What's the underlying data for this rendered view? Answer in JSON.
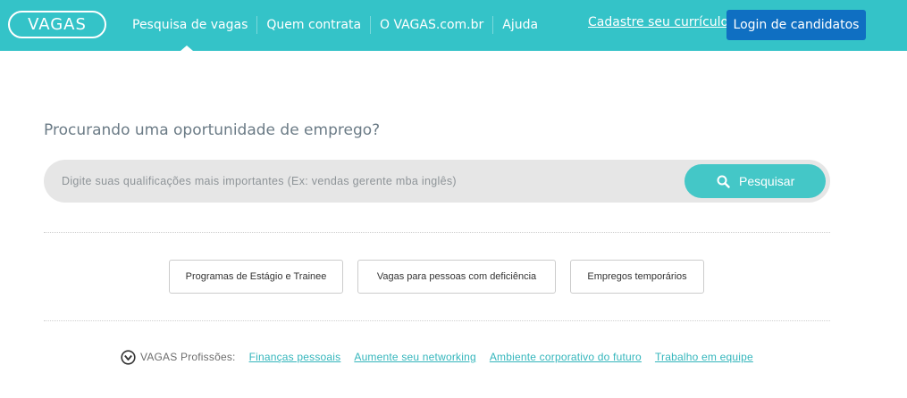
{
  "header": {
    "logo_text": "VAGAS",
    "nav": [
      {
        "label": "Pesquisa de vagas",
        "active": true
      },
      {
        "label": "Quem contrata"
      },
      {
        "label": "O VAGAS.com.br"
      },
      {
        "label": "Ajuda"
      }
    ],
    "signup_link": "Cadastre seu currículo",
    "login_button": "Login de candidatos"
  },
  "search": {
    "headline": "Procurando uma oportunidade de emprego?",
    "placeholder": "Digite suas qualificações mais importantes (Ex: vendas gerente mba inglês)",
    "button_label": "Pesquisar",
    "button_icon": "search-icon"
  },
  "quick_links": [
    "Programas de Estágio e Trainee",
    "Vagas para pessoas com deficiência",
    "Empregos temporários"
  ],
  "professions": {
    "label": "VAGAS Profissões:",
    "icon": "vagas-check-icon",
    "links": [
      "Finanças pessoais",
      "Aumente seu networking",
      "Ambiente corporativo do futuro",
      "Trabalho em equipe"
    ]
  },
  "colors": {
    "header_bg": "#34c3c8",
    "login_button_bg": "#0f6fc2",
    "search_button_bg": "#44c7c7",
    "link": "#34b6bc"
  }
}
